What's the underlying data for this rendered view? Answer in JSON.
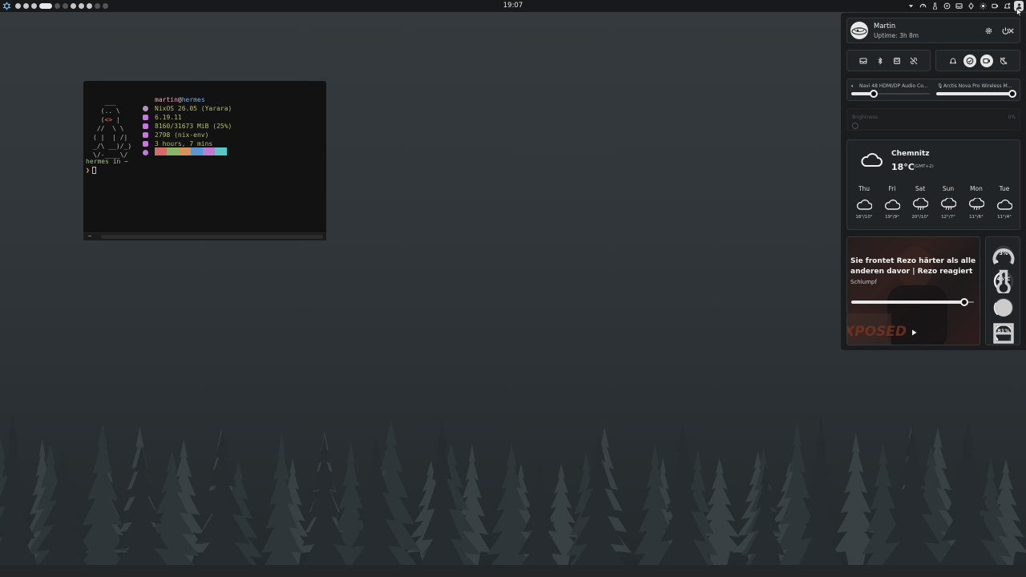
{
  "topbar": {
    "clock": "19:07",
    "workspaces": [
      {
        "state": "on"
      },
      {
        "state": "on"
      },
      {
        "state": "on"
      },
      {
        "state": "active"
      },
      {
        "state": "dim"
      },
      {
        "state": "dim"
      },
      {
        "state": "on"
      },
      {
        "state": "on"
      },
      {
        "state": "on"
      },
      {
        "state": "dim"
      },
      {
        "state": "dim"
      }
    ],
    "tray_icons": [
      "chevron-down-icon",
      "cpu-gauge-icon",
      "temperature-icon",
      "disk-icon",
      "inbox-icon",
      "network-icon",
      "brightness-icon",
      "screen-record-icon",
      "notification-icon",
      "user-icon"
    ]
  },
  "terminal": {
    "user": "martin",
    "at": "@",
    "host": "hermes",
    "info": [
      {
        "value": "NixOS 26.05 (Yarara)",
        "color": "#b294bb"
      },
      {
        "value": "6.19.11",
        "color": "#c678dd"
      },
      {
        "value": "8160/31673 MiB (25%)",
        "color": "#c678dd"
      },
      {
        "value": "2798 (nix-env)",
        "color": "#c678dd"
      },
      {
        "value": "3 hours, 7 mins",
        "color": "#c678dd"
      }
    ],
    "palette": [
      "#d96a6a",
      "#8bb36b",
      "#d7915a",
      "#5b95d2",
      "#c07bd0",
      "#5fc7c3"
    ],
    "prompt_host": "hermes",
    "prompt_in": " in ",
    "prompt_dir": "~",
    "prompt_symbol": "❯",
    "footer_tab": "~"
  },
  "panel": {
    "profile": {
      "name": "Martin",
      "uptime": "Uptime: 3h 8m"
    },
    "quick_settings_left": [
      "inbox-icon",
      "bluetooth-icon",
      "display-icon",
      "link-off-icon"
    ],
    "quick_settings_right": [
      "bell-icon",
      "dnd-icon",
      "record-icon",
      "night-mode-icon"
    ],
    "audio": {
      "output_name": "Navi 48 HDMI/DP Audio Co...",
      "output_level": 0.26,
      "input_name": "Arctis Nova Pro Wireless M...",
      "input_level": 1.0
    },
    "brightness": {
      "label": "Brightness",
      "value": "0%"
    },
    "weather": {
      "city": "Chemnitz",
      "temp": "18°C",
      "timezone": "(GMT+2)",
      "forecast": [
        {
          "day": "Thu",
          "icon": "cloud-icon",
          "range": "18°/10°"
        },
        {
          "day": "Fri",
          "icon": "cloud-icon",
          "range": "19°/9°"
        },
        {
          "day": "Sat",
          "icon": "rain-icon",
          "range": "20°/10°"
        },
        {
          "day": "Sun",
          "icon": "rain-icon",
          "range": "12°/7°"
        },
        {
          "day": "Mon",
          "icon": "rain-icon",
          "range": "11°/6°"
        },
        {
          "day": "Tue",
          "icon": "cloud-icon",
          "range": "11°/4°"
        }
      ]
    },
    "media": {
      "title": "Sie frontet Rezo härter als alle anderen davor | Rezo reagiert",
      "artist": "Schlumpf",
      "progress": 0.95,
      "thumbnail_text": "XPOSED"
    },
    "stats": [
      {
        "label": "3%",
        "fraction": 0.03,
        "icon": "cpu-icon"
      },
      {
        "label": "46°C",
        "fraction": 0.46,
        "icon": "temperature-icon"
      },
      {
        "label": "27%",
        "fraction": 0.27,
        "icon": "memory-icon"
      },
      {
        "label": "81%",
        "fraction": 0.81,
        "icon": "disk-icon"
      }
    ]
  }
}
